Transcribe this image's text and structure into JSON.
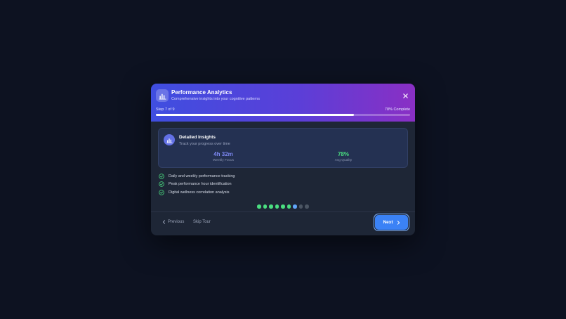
{
  "header": {
    "title": "Performance Analytics",
    "subtitle": "Comprehensive insights into your cognitive patterns",
    "icon": "bar-chart-icon",
    "step_label": "Step 7 of 9",
    "percent_label": "78% Complete",
    "progress_fraction": 0.78,
    "gradient_colors": [
      "#3f4ee0",
      "#5a3fd8",
      "#8a2fc4"
    ]
  },
  "card": {
    "title": "Detailed Insights",
    "subtitle": "Track your progress over time",
    "icon": "bar-chart-icon",
    "stats": [
      {
        "value": "4h 32m",
        "label": "Weekly Focus",
        "color": "#7c87f0"
      },
      {
        "value": "78%",
        "label": "Avg Quality",
        "color": "#4ade80"
      }
    ]
  },
  "features": [
    {
      "text": "Daily and weekly performance tracking",
      "icon": "check-circle-icon"
    },
    {
      "text": "Peak performance hour identification",
      "icon": "check-circle-icon"
    },
    {
      "text": "Digital wellness correlation analysis",
      "icon": "check-circle-icon"
    }
  ],
  "pagination": {
    "total": 9,
    "current": 7,
    "colors": {
      "done": "#4ade80",
      "current": "#60a5fa",
      "upcoming": "#4b5563"
    }
  },
  "footer": {
    "previous_label": "Previous",
    "skip_label": "Skip Tour",
    "next_label": "Next"
  },
  "colors": {
    "accent": "#3b82f6",
    "success": "#4ade80"
  }
}
